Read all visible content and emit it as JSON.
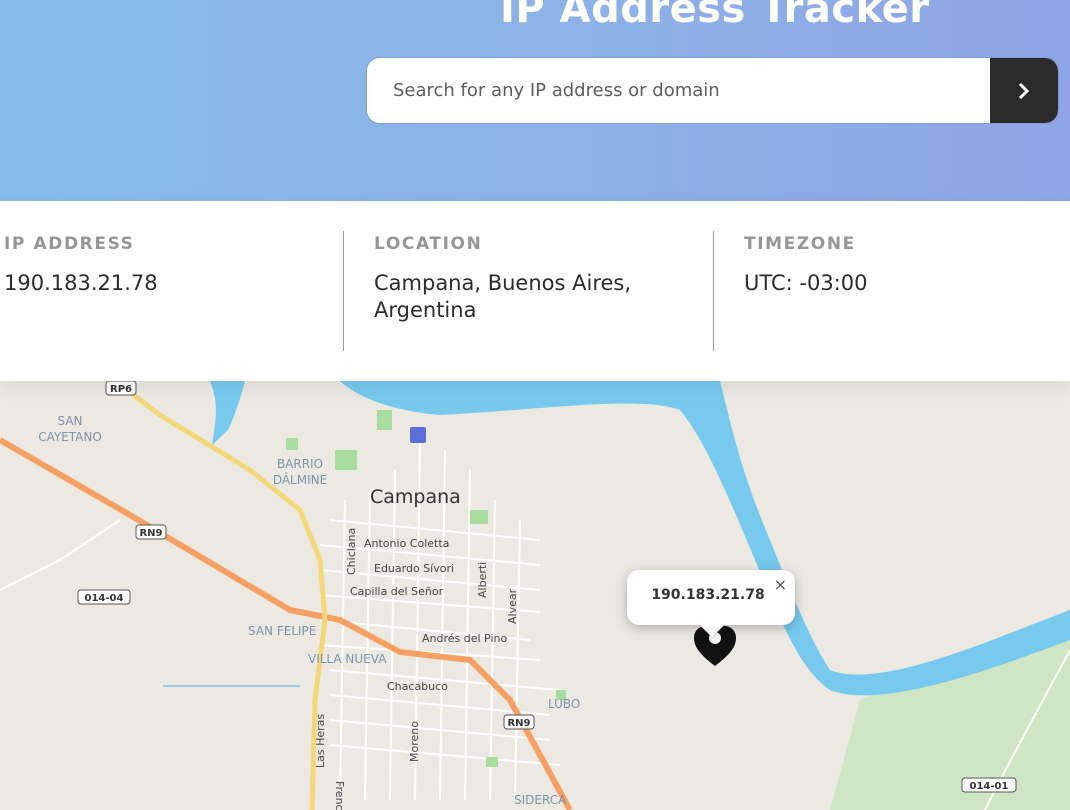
{
  "header": {
    "title": "IP Address Tracker",
    "search_placeholder": "Search for any IP address or domain",
    "search_value": "",
    "submit_icon": "chevron-right-icon"
  },
  "info": {
    "ip_label": "IP ADDRESS",
    "ip_value": "190.183.21.78",
    "location_label": "LOCATION",
    "location_value": "Campana, Buenos Aires, Argentina",
    "timezone_label": "TIMEZONE",
    "timezone_value": "UTC: -03:00"
  },
  "map": {
    "labels": {
      "campana": "Campana",
      "san_cayetano": "SAN CAYETANO",
      "barrio_dalmine": "BARRIO DÁLMINE",
      "san_felipe": "SAN FELIPE",
      "villa_nueva": "VILLA NUEVA",
      "lubo": "LUBO",
      "siderca": "SIDERCA",
      "antonio_coletta": "Antonio Coletta",
      "eduardo_sivori": "Eduardo Sívori",
      "capilla_del_senor": "Capilla del Señor",
      "andres_del_pino": "Andrés del Pino",
      "chacabuco": "Chacabuco",
      "chiclana": "Chiclana",
      "alberti": "Alberti",
      "alvear": "Alvear",
      "las_heras": "Las Heras",
      "moreno": "Moreno",
      "french": "French",
      "rp6": "RP6",
      "rn9_a": "RN9",
      "rn9_b": "RN9",
      "r014_04": "014-04",
      "r014_01": "014-01"
    },
    "popup_text": "190.183.21.78",
    "popup_close": "×",
    "marker_icon": "location-pin-icon",
    "colors": {
      "water": "#78c9ee",
      "land": "#ece9e3",
      "highway": "#f7a064",
      "road": "#f3d779",
      "park": "#a9dda0"
    }
  }
}
